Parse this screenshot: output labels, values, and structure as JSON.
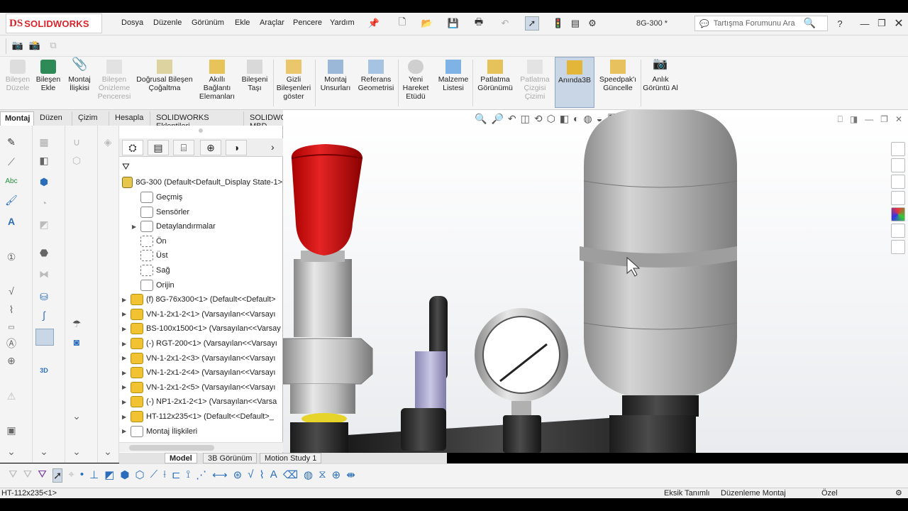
{
  "app": {
    "logo_ds": "DS",
    "logo_text": "SOLIDWORKS",
    "menu": [
      "Dosya",
      "Düzenle",
      "Görünüm",
      "Ekle",
      "Araçlar",
      "Pencere",
      "Yardım"
    ],
    "document_title": "8G-300 *",
    "search_placeholder": "Tartışma Forumunu Ara"
  },
  "ribbon": [
    {
      "label": "Bileşen Düzele",
      "disabled": true
    },
    {
      "label": "Bileşen Ekle",
      "disabled": false
    },
    {
      "label": "Montaj İlişkisi",
      "disabled": false
    },
    {
      "label": "Bileşen Önizleme Penceresi",
      "disabled": true
    },
    {
      "label": "Doğrusal Bileşen Çoğaltma",
      "disabled": false
    },
    {
      "label": "Akıllı Bağlantı Elemanları",
      "disabled": false
    },
    {
      "label": "Bileşeni Taşı",
      "disabled": false
    },
    {
      "label": "Gizli Bileşenleri göster",
      "disabled": false
    },
    {
      "label": "Montaj Unsurları",
      "disabled": false
    },
    {
      "label": "Referans Geometrisi",
      "disabled": false
    },
    {
      "label": "Yeni Hareket Etüdü",
      "disabled": false
    },
    {
      "label": "Malzeme Listesi",
      "disabled": false
    },
    {
      "label": "Patlatma Görünümü",
      "disabled": false
    },
    {
      "label": "Patlatma Çizgisi Çizimi",
      "disabled": true
    },
    {
      "label": "Anında3B",
      "disabled": false
    },
    {
      "label": "Speedpak'ı Güncelle",
      "disabled": false
    },
    {
      "label": "Anlık Görüntü Al",
      "disabled": false
    }
  ],
  "command_tabs": [
    "Montaj",
    "Düzen",
    "Çizim",
    "Hesapla",
    "SOLIDWORKS Eklentileri",
    "SOLIDWORKS MBD"
  ],
  "tree": {
    "root": "8G-300  (Default<Default_Display State-1>",
    "items": [
      {
        "label": "Geçmiş",
        "icon": "folder",
        "expand": false
      },
      {
        "label": "Sensörler",
        "icon": "folder",
        "expand": false
      },
      {
        "label": "Detaylandırmalar",
        "icon": "folder",
        "expand": true
      },
      {
        "label": "Ön",
        "icon": "plane",
        "expand": false
      },
      {
        "label": "Üst",
        "icon": "plane",
        "expand": false
      },
      {
        "label": "Sağ",
        "icon": "plane",
        "expand": false
      },
      {
        "label": "Orijin",
        "icon": "origin",
        "expand": false
      },
      {
        "label": "(f) 8G-76x300<1> (Default<<Default>",
        "icon": "part",
        "expand": true
      },
      {
        "label": "VN-1-2x1-2<1> (Varsayılan<<Varsayı",
        "icon": "part",
        "expand": true
      },
      {
        "label": "BS-100x1500<1> (Varsayılan<<Varsay",
        "icon": "part",
        "expand": true
      },
      {
        "label": "(-) RGT-200<1> (Varsayılan<<Varsayı",
        "icon": "part",
        "expand": true
      },
      {
        "label": "VN-1-2x1-2<3> (Varsayılan<<Varsayı",
        "icon": "part",
        "expand": true
      },
      {
        "label": "VN-1-2x1-2<4> (Varsayılan<<Varsayı",
        "icon": "part",
        "expand": true
      },
      {
        "label": "VN-1-2x1-2<5> (Varsayılan<<Varsayı",
        "icon": "part",
        "expand": true
      },
      {
        "label": "(-) NP1-2x1-2<1> (Varsayılan<<Varsa",
        "icon": "part",
        "expand": true
      },
      {
        "label": "HT-112x235<1> (Default<<Default>_",
        "icon": "part",
        "expand": true
      },
      {
        "label": "Montaj İlişkileri",
        "icon": "mates",
        "expand": true
      }
    ]
  },
  "bottom_tabs": [
    "Model",
    "3B Görünüm",
    "Motion Study 1"
  ],
  "status": {
    "selection": "HT-112x235<1>",
    "definition": "Eksik Tanımlı",
    "mode": "Düzenleme Montaj",
    "units": "Özel"
  },
  "colors": {
    "brand": "#d8232a",
    "knob": "#d01818",
    "metal": "#c9c9c9",
    "dark": "#2b2b2b"
  }
}
